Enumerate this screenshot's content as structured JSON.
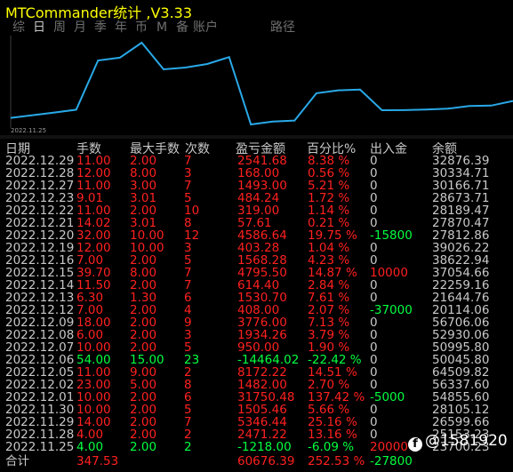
{
  "app": {
    "title": "MTCommander统计 ,V3.33"
  },
  "tabs": [
    {
      "label": "综",
      "active": false
    },
    {
      "label": "日",
      "active": true
    },
    {
      "label": "周",
      "active": false
    },
    {
      "label": "月",
      "active": false
    },
    {
      "label": "季",
      "active": false
    },
    {
      "label": "年",
      "active": false
    },
    {
      "label": "币",
      "active": false
    },
    {
      "label": "M",
      "active": false
    },
    {
      "label": "备",
      "active": false
    },
    {
      "label": "账户",
      "active": false
    },
    {
      "label": "路径",
      "active": false
    }
  ],
  "chart_data": {
    "type": "line",
    "x_start_label": "2022.11.25",
    "values": [
      32876.39,
      30334.71,
      30166.71,
      28673.71,
      28189.47,
      27870.47,
      27812.86,
      39026.22,
      38622.94,
      37054.66,
      22259.16,
      21644.76,
      20114.06,
      56706.06,
      52930.06,
      50995.8,
      50045.8,
      64509.82,
      56337.6,
      54855.6,
      28105.12,
      26599.66,
      25153.23,
      23700.23
    ],
    "color": "#29a9e8"
  },
  "table": {
    "headers": [
      "日期",
      "手数",
      "最大手数",
      "次数",
      "盈亏金额",
      "百分比%",
      "出入金",
      "余额"
    ],
    "rows": [
      {
        "date": "2022.12.29",
        "lots": "11.00",
        "max_lots": "2.00",
        "count": "7",
        "pnl": "2541.68",
        "pct": "8.38 %",
        "flow": "0",
        "balance": "32876.39",
        "lots_c": "red",
        "max_c": "red",
        "count_c": "red",
        "pnl_c": "red",
        "pct_c": "red",
        "flow_c": "white"
      },
      {
        "date": "2022.12.28",
        "lots": "12.00",
        "max_lots": "8.00",
        "count": "3",
        "pnl": "168.00",
        "pct": "0.56 %",
        "flow": "0",
        "balance": "30334.71",
        "lots_c": "red",
        "max_c": "red",
        "count_c": "red",
        "pnl_c": "red",
        "pct_c": "red",
        "flow_c": "white"
      },
      {
        "date": "2022.12.27",
        "lots": "11.00",
        "max_lots": "3.00",
        "count": "7",
        "pnl": "1493.00",
        "pct": "5.21 %",
        "flow": "0",
        "balance": "30166.71",
        "lots_c": "red",
        "max_c": "red",
        "count_c": "red",
        "pnl_c": "red",
        "pct_c": "red",
        "flow_c": "white"
      },
      {
        "date": "2022.12.23",
        "lots": "9.01",
        "max_lots": "3.01",
        "count": "5",
        "pnl": "484.24",
        "pct": "1.72 %",
        "flow": "0",
        "balance": "28673.71",
        "lots_c": "red",
        "max_c": "red",
        "count_c": "red",
        "pnl_c": "red",
        "pct_c": "red",
        "flow_c": "white"
      },
      {
        "date": "2022.12.22",
        "lots": "11.00",
        "max_lots": "2.00",
        "count": "10",
        "pnl": "319.00",
        "pct": "1.14 %",
        "flow": "0",
        "balance": "28189.47",
        "lots_c": "red",
        "max_c": "red",
        "count_c": "red",
        "pnl_c": "red",
        "pct_c": "red",
        "flow_c": "white"
      },
      {
        "date": "2022.12.21",
        "lots": "14.02",
        "max_lots": "3.01",
        "count": "8",
        "pnl": "57.61",
        "pct": "0.21 %",
        "flow": "0",
        "balance": "27870.47",
        "lots_c": "red",
        "max_c": "red",
        "count_c": "red",
        "pnl_c": "red",
        "pct_c": "red",
        "flow_c": "white"
      },
      {
        "date": "2022.12.20",
        "lots": "32.00",
        "max_lots": "10.00",
        "count": "12",
        "pnl": "4586.64",
        "pct": "19.75 %",
        "flow": "-15800",
        "balance": "27812.86",
        "lots_c": "red",
        "max_c": "red",
        "count_c": "red",
        "pnl_c": "red",
        "pct_c": "red",
        "flow_c": "green"
      },
      {
        "date": "2022.12.19",
        "lots": "12.00",
        "max_lots": "10.00",
        "count": "3",
        "pnl": "403.28",
        "pct": "1.04 %",
        "flow": "0",
        "balance": "39026.22",
        "lots_c": "red",
        "max_c": "red",
        "count_c": "red",
        "pnl_c": "red",
        "pct_c": "red",
        "flow_c": "white"
      },
      {
        "date": "2022.12.16",
        "lots": "7.00",
        "max_lots": "2.00",
        "count": "5",
        "pnl": "1568.28",
        "pct": "4.23 %",
        "flow": "0",
        "balance": "38622.94",
        "lots_c": "red",
        "max_c": "red",
        "count_c": "red",
        "pnl_c": "red",
        "pct_c": "red",
        "flow_c": "white"
      },
      {
        "date": "2022.12.15",
        "lots": "39.70",
        "max_lots": "8.00",
        "count": "7",
        "pnl": "4795.50",
        "pct": "14.87 %",
        "flow": "10000",
        "balance": "37054.66",
        "lots_c": "red",
        "max_c": "red",
        "count_c": "red",
        "pnl_c": "red",
        "pct_c": "red",
        "flow_c": "red"
      },
      {
        "date": "2022.12.14",
        "lots": "11.50",
        "max_lots": "2.00",
        "count": "7",
        "pnl": "614.40",
        "pct": "2.84 %",
        "flow": "0",
        "balance": "22259.16",
        "lots_c": "red",
        "max_c": "red",
        "count_c": "red",
        "pnl_c": "red",
        "pct_c": "red",
        "flow_c": "white"
      },
      {
        "date": "2022.12.13",
        "lots": "6.30",
        "max_lots": "1.30",
        "count": "6",
        "pnl": "1530.70",
        "pct": "7.61 %",
        "flow": "0",
        "balance": "21644.76",
        "lots_c": "red",
        "max_c": "red",
        "count_c": "red",
        "pnl_c": "red",
        "pct_c": "red",
        "flow_c": "white"
      },
      {
        "date": "2022.12.12",
        "lots": "7.00",
        "max_lots": "2.00",
        "count": "4",
        "pnl": "408.00",
        "pct": "2.07 %",
        "flow": "-37000",
        "balance": "20114.06",
        "lots_c": "red",
        "max_c": "red",
        "count_c": "red",
        "pnl_c": "red",
        "pct_c": "red",
        "flow_c": "green"
      },
      {
        "date": "2022.12.09",
        "lots": "18.00",
        "max_lots": "2.00",
        "count": "9",
        "pnl": "3776.00",
        "pct": "7.13 %",
        "flow": "0",
        "balance": "56706.06",
        "lots_c": "red",
        "max_c": "red",
        "count_c": "red",
        "pnl_c": "red",
        "pct_c": "red",
        "flow_c": "white"
      },
      {
        "date": "2022.12.08",
        "lots": "6.00",
        "max_lots": "2.00",
        "count": "3",
        "pnl": "1934.26",
        "pct": "3.79 %",
        "flow": "0",
        "balance": "52930.06",
        "lots_c": "red",
        "max_c": "red",
        "count_c": "red",
        "pnl_c": "red",
        "pct_c": "red",
        "flow_c": "white"
      },
      {
        "date": "2022.12.07",
        "lots": "10.00",
        "max_lots": "2.00",
        "count": "5",
        "pnl": "950.00",
        "pct": "1.90 %",
        "flow": "0",
        "balance": "50995.80",
        "lots_c": "red",
        "max_c": "red",
        "count_c": "red",
        "pnl_c": "red",
        "pct_c": "red",
        "flow_c": "white"
      },
      {
        "date": "2022.12.06",
        "lots": "54.00",
        "max_lots": "15.00",
        "count": "23",
        "pnl": "-14464.02",
        "pct": "-22.42 %",
        "flow": "0",
        "balance": "50045.80",
        "lots_c": "green",
        "max_c": "green",
        "count_c": "green",
        "pnl_c": "green",
        "pct_c": "green",
        "flow_c": "white"
      },
      {
        "date": "2022.12.05",
        "lots": "11.00",
        "max_lots": "9.00",
        "count": "2",
        "pnl": "8172.22",
        "pct": "14.51 %",
        "flow": "0",
        "balance": "64509.82",
        "lots_c": "red",
        "max_c": "red",
        "count_c": "red",
        "pnl_c": "red",
        "pct_c": "red",
        "flow_c": "white"
      },
      {
        "date": "2022.12.02",
        "lots": "23.00",
        "max_lots": "5.00",
        "count": "8",
        "pnl": "1482.00",
        "pct": "2.70 %",
        "flow": "0",
        "balance": "56337.60",
        "lots_c": "red",
        "max_c": "red",
        "count_c": "red",
        "pnl_c": "red",
        "pct_c": "red",
        "flow_c": "white"
      },
      {
        "date": "2022.12.01",
        "lots": "10.00",
        "max_lots": "2.00",
        "count": "6",
        "pnl": "31750.48",
        "pct": "137.42 %",
        "flow": "-5000",
        "balance": "54855.60",
        "lots_c": "red",
        "max_c": "red",
        "count_c": "red",
        "pnl_c": "red",
        "pct_c": "red",
        "flow_c": "green"
      },
      {
        "date": "2022.11.30",
        "lots": "10.00",
        "max_lots": "2.00",
        "count": "5",
        "pnl": "1505.46",
        "pct": "5.66 %",
        "flow": "0",
        "balance": "28105.12",
        "lots_c": "red",
        "max_c": "red",
        "count_c": "red",
        "pnl_c": "red",
        "pct_c": "red",
        "flow_c": "white"
      },
      {
        "date": "2022.11.29",
        "lots": "14.00",
        "max_lots": "2.00",
        "count": "7",
        "pnl": "5346.44",
        "pct": "25.16 %",
        "flow": "0",
        "balance": "26599.66",
        "lots_c": "red",
        "max_c": "red",
        "count_c": "red",
        "pnl_c": "red",
        "pct_c": "red",
        "flow_c": "white"
      },
      {
        "date": "2022.11.28",
        "lots": "4.00",
        "max_lots": "2.00",
        "count": "2",
        "pnl": "2471.22",
        "pct": "13.16 %",
        "flow": "0",
        "balance": "25153.23",
        "lots_c": "red",
        "max_c": "red",
        "count_c": "red",
        "pnl_c": "red",
        "pct_c": "red",
        "flow_c": "white"
      },
      {
        "date": "2022.11.25",
        "lots": "4.00",
        "max_lots": "2.00",
        "count": "2",
        "pnl": "-1218.00",
        "pct": "-6.09 %",
        "flow": "20000",
        "balance": "23700.23",
        "lots_c": "green",
        "max_c": "green",
        "count_c": "green",
        "pnl_c": "green",
        "pct_c": "green",
        "flow_c": "red"
      }
    ],
    "footer": {
      "label": "合计",
      "lots": "347.53",
      "pnl": "60676.39",
      "pct": "252.53 %",
      "flow": "-27800"
    }
  },
  "watermark": {
    "logo": "f",
    "text": "@1581920"
  },
  "colors": {
    "title": "#ffff00",
    "positive": "#ff2020",
    "negative": "#00ff40",
    "line": "#29a9e8"
  }
}
